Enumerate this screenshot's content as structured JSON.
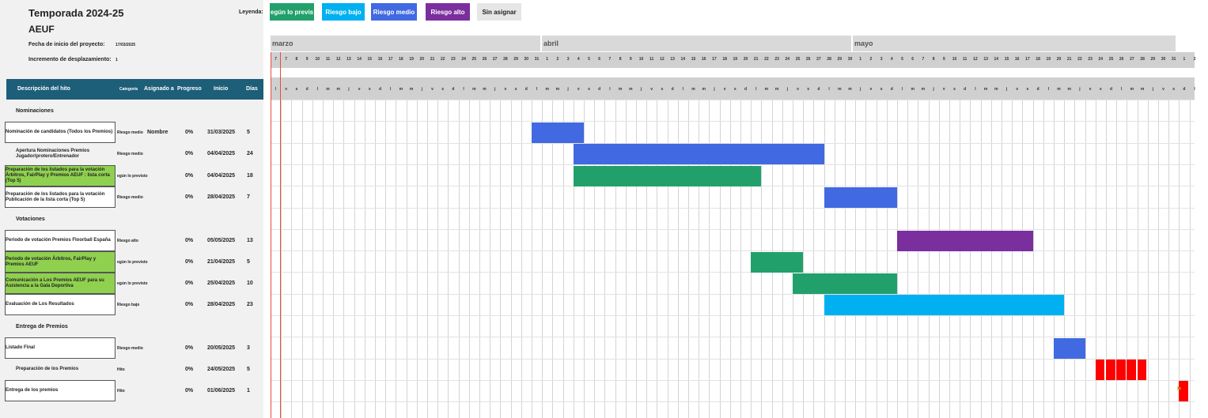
{
  "project": {
    "title": "Temporada 2024-25",
    "org": "AEUF",
    "start_label": "Fecha de inicio del proyecto:",
    "start_value": "17/03/2025",
    "increment_label": "Incremento de desplazamiento:",
    "increment_value": "1"
  },
  "legend": {
    "label": "Leyenda:",
    "items": [
      {
        "label": "egún lo previs",
        "color": "#22a06b"
      },
      {
        "label": "Riesgo bajo",
        "color": "#00b0f0"
      },
      {
        "label": "Riesgo medio",
        "color": "#4169e1"
      },
      {
        "label": "Riesgo alto",
        "color": "#7b2f9e"
      },
      {
        "label": "Sin asignar",
        "color": "#e6e6e6"
      }
    ]
  },
  "table_headers": {
    "desc": "Descripción del hito",
    "category": "Categoría",
    "assigned": "Asignado a",
    "progress": "Progreso",
    "start": "Inicio",
    "days": "Días"
  },
  "sections": [
    {
      "label": "Nominaciones"
    },
    {
      "label": "Votaciones"
    },
    {
      "label": "Entrega de Premios"
    }
  ],
  "tasks": [
    {
      "desc": "Nominación de candidatos (Todos los Premios)",
      "category": "Riesgo medio",
      "assigned": "Nombre",
      "progress": "0%",
      "start": "31/03/2025",
      "days": "5",
      "style": "white",
      "color": "#4169e1"
    },
    {
      "desc": "Apertura Nominaciones Premios Jugador/protero/Entrenador",
      "category": "Riesgo medio",
      "assigned": "",
      "progress": "0%",
      "start": "04/04/2025",
      "days": "24",
      "style": "plain",
      "color": "#4169e1"
    },
    {
      "desc": "Preparación de los listados para la votación Árbitros, FairPlay y Premios AEUF : lista corta (Top 5)",
      "category": "egún lo previsto",
      "assigned": "",
      "progress": "0%",
      "start": "04/04/2025",
      "days": "18",
      "style": "green",
      "color": "#22a06b"
    },
    {
      "desc": "Preparación de los listados para la votación Publicación de la lista corta (Top 5)",
      "category": "Riesgo medio",
      "assigned": "",
      "progress": "0%",
      "start": "28/04/2025",
      "days": "7",
      "style": "white",
      "color": "#4169e1"
    },
    {
      "desc": "Periodo de votación Premios Floorball España",
      "category": "Riesgo alto",
      "assigned": "",
      "progress": "0%",
      "start": "05/05/2025",
      "days": "13",
      "style": "white",
      "color": "#7b2f9e"
    },
    {
      "desc": "Periodo de votación Árbitros, FairPlay y Premios AEUF",
      "category": "egún lo previsto",
      "assigned": "",
      "progress": "0%",
      "start": "21/04/2025",
      "days": "5",
      "style": "green",
      "color": "#22a06b"
    },
    {
      "desc": "Comunicación a Los Premios AEUF para su Asistencia a la Gala Deportiva",
      "category": "egún lo previsto",
      "assigned": "",
      "progress": "0%",
      "start": "25/04/2025",
      "days": "10",
      "style": "green",
      "color": "#22a06b"
    },
    {
      "desc": "Evaluación de Los Resultados",
      "category": "Riesgo bajo",
      "assigned": "",
      "progress": "0%",
      "start": "28/04/2025",
      "days": "23",
      "style": "white",
      "color": "#00b0f0"
    },
    {
      "desc": "Listado Final",
      "category": "Riesgo medio",
      "assigned": "",
      "progress": "0%",
      "start": "20/05/2025",
      "days": "3",
      "style": "white",
      "color": "#4169e1"
    },
    {
      "desc": "Preparación de los Premios",
      "category": "Hito",
      "assigned": "",
      "progress": "0%",
      "start": "24/05/2025",
      "days": "5",
      "style": "plain",
      "color": "#ff0000"
    },
    {
      "desc": "Entrega de los premios",
      "category": "Hito",
      "assigned": "",
      "progress": "0%",
      "start": "01/06/2025",
      "days": "1",
      "style": "white",
      "color": "#ff0000"
    }
  ],
  "timeline": {
    "months": [
      "marzo",
      "abril",
      "mayo"
    ],
    "day_numbers": [
      "7",
      "7",
      "8",
      "9",
      "10",
      "11",
      "12",
      "13",
      "14",
      "15",
      "16",
      "17",
      "18",
      "19",
      "20",
      "21",
      "22",
      "23",
      "24",
      "25",
      "26",
      "27",
      "28",
      "29",
      "30",
      "31",
      "1",
      "2",
      "3",
      "4",
      "5",
      "6",
      "7",
      "8",
      "9",
      "10",
      "11",
      "12",
      "13",
      "14",
      "15",
      "16",
      "17",
      "18",
      "19",
      "20",
      "21",
      "22",
      "23",
      "24",
      "25",
      "26",
      "27",
      "28",
      "29",
      "30",
      "1",
      "2",
      "3",
      "4",
      "5",
      "6",
      "7",
      "8",
      "9",
      "10",
      "11",
      "12",
      "13",
      "14",
      "15",
      "16",
      "17",
      "18",
      "19",
      "20",
      "21",
      "22",
      "23",
      "24",
      "25",
      "26",
      "27",
      "28",
      "29",
      "30",
      "31",
      "1",
      "2"
    ],
    "weekdays": [
      "l",
      "v",
      "s",
      "d",
      "l",
      "m",
      "m",
      "j",
      "v",
      "s",
      "d",
      "l",
      "m",
      "m",
      "j",
      "v",
      "s",
      "d",
      "l",
      "m",
      "m",
      "j",
      "v",
      "s",
      "d",
      "l",
      "m",
      "m",
      "j",
      "v",
      "s",
      "d",
      "l",
      "m",
      "m",
      "j",
      "v",
      "s",
      "d",
      "l",
      "m",
      "m",
      "j",
      "v",
      "s",
      "d",
      "l",
      "m",
      "m",
      "j",
      "v",
      "s",
      "d",
      "l",
      "m",
      "m",
      "j",
      "v",
      "s",
      "d",
      "l",
      "m",
      "m",
      "j",
      "v",
      "s",
      "d",
      "l",
      "m",
      "m",
      "j",
      "v",
      "s",
      "d",
      "l",
      "m",
      "m",
      "j",
      "v",
      "s",
      "d",
      "l",
      "m",
      "m",
      "j",
      "v",
      "s",
      "d",
      "l"
    ]
  }
}
